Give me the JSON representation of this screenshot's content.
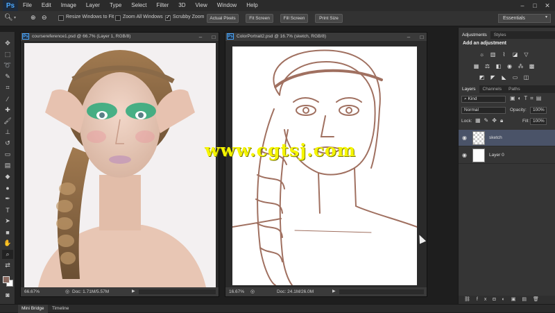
{
  "app": {
    "logo": "Ps",
    "menu": [
      "File",
      "Edit",
      "Image",
      "Layer",
      "Type",
      "Select",
      "Filter",
      "3D",
      "View",
      "Window",
      "Help"
    ]
  },
  "options_bar": {
    "zoom_value": "",
    "resize_windows_label": "Resize Windows to Fit",
    "resize_windows_checked": false,
    "zoom_all_label": "Zoom All Windows",
    "zoom_all_checked": false,
    "scrubby_label": "Scrubby Zoom",
    "scrubby_checked": true,
    "actual_pixels": "Actual Pixels",
    "fit_screen": "Fit Screen",
    "fill_screen": "Fill Screen",
    "print_size": "Print Size",
    "workspace": "Essentials"
  },
  "colors": {
    "foreground": "#8b6a60",
    "background": "#ffffff",
    "accent": "#4aa8ff"
  },
  "documents": [
    {
      "title": "coursereference1.psd @ 66.7% (Layer 1, RGB/8)",
      "zoom": "66.67%",
      "doc_size": "Doc: 1.71M/5.57M"
    },
    {
      "title": "ColorPortrait2.psd @ 16.7% (sketch, RGB/8)",
      "zoom": "16.67%",
      "doc_size": "Doc: 24.1M/26.0M"
    }
  ],
  "watermark": "www.cgtsj.com",
  "adjustments": {
    "tabs": [
      "Adjustments",
      "Styles"
    ],
    "heading": "Add an adjustment"
  },
  "layers_panel": {
    "tabs": [
      "Layers",
      "Channels",
      "Paths"
    ],
    "filter_kind": "Kind",
    "blend_mode": "Normal",
    "opacity_label": "Opacity:",
    "opacity_value": "100%",
    "lock_label": "Lock:",
    "fill_label": "Fill:",
    "fill_value": "100%",
    "layers": [
      {
        "name": "sketch",
        "selected": true
      },
      {
        "name": "Layer 0",
        "selected": false
      }
    ]
  },
  "bottom_tabs": [
    "Mini Bridge",
    "Timeline"
  ]
}
